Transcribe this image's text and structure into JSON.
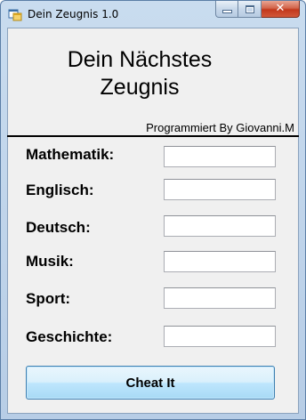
{
  "window": {
    "title": "Dein Zeugnis 1.0",
    "icon": "winforms-app-icon",
    "close_glyph": "✕"
  },
  "header": {
    "title_line1": "Dein Nächstes",
    "title_line2": "Zeugnis",
    "credit": "Programmiert By Giovanni.M"
  },
  "fields": [
    {
      "label": "Mathematik:",
      "value": ""
    },
    {
      "label": "Englisch:",
      "value": ""
    },
    {
      "label": "Deutsch:",
      "value": ""
    },
    {
      "label": "Musik:",
      "value": ""
    },
    {
      "label": "Sport:",
      "value": ""
    },
    {
      "label": "Geschichte:",
      "value": ""
    }
  ],
  "actions": {
    "cheat_label": "Cheat It"
  }
}
